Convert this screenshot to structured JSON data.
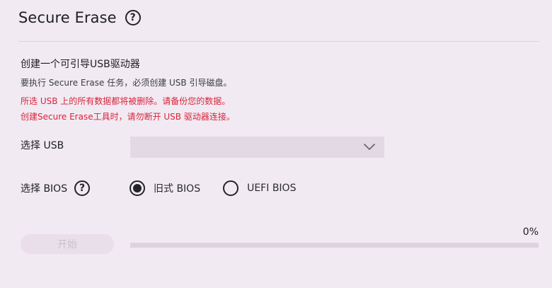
{
  "header": {
    "title": "Secure Erase",
    "help_icon": "question-circle-icon",
    "help_glyph": "?"
  },
  "section": {
    "title": "创建一个可引导USB驱动器",
    "description": "要执行 Secure Erase 任务，必须创建 USB 引导磁盘。",
    "warnings": [
      "所选 USB 上的所有数据都将被删除。请备份您的数据。",
      "创建Secure Erase工具时，请勿断开 USB 驱动器连接。"
    ],
    "warning_color": "#d9233c"
  },
  "usb": {
    "label": "选择 USB",
    "selected_value": "",
    "dropdown_icon": "chevron-down-icon"
  },
  "bios": {
    "label": "选择 BIOS",
    "help_icon": "question-circle-icon",
    "help_glyph": "?",
    "options": [
      {
        "label": "旧式 BIOS",
        "selected": true
      },
      {
        "label": "UEFI BIOS",
        "selected": false
      }
    ]
  },
  "actions": {
    "start_label": "开始",
    "start_enabled": false
  },
  "progress": {
    "percent_text": "0%",
    "value": 0
  },
  "colors": {
    "background": "#f1eaf2",
    "select_background": "#e3d9e4",
    "track": "#ddd3de",
    "disabled_button_text": "#cbbfcd"
  }
}
